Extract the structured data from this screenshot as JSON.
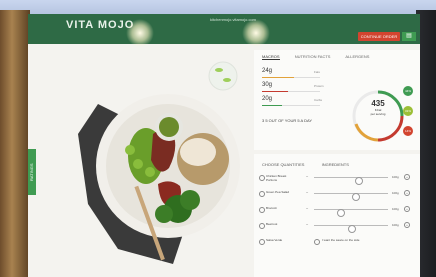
{
  "header": {
    "logo": "VITA MOJO",
    "url": "kitchenmojo.vitamojo.com",
    "continue_label": "CONTINUE ORDER",
    "cart_icon": "cart-icon"
  },
  "sidetab": {
    "label": "RATINGS"
  },
  "nutrition": {
    "tabs": [
      "MACROS",
      "NUTRITION FACTS",
      "ALLERGENS"
    ],
    "macros": [
      {
        "value": "24g",
        "label": "Fats",
        "color": "#e2a23a",
        "fraction": 0.55
      },
      {
        "value": "30g",
        "label": "Protein",
        "color": "#c43a2f",
        "fraction": 0.45
      },
      {
        "value": "20g",
        "label": "Carbs",
        "color": "#3f9b52",
        "fraction": 0.35
      }
    ],
    "five_a_day": "3  5 OUT OF YOUR 5 A DAY",
    "kcal_value": "435",
    "kcal_unit": "KCal",
    "kcal_sub": "per serving",
    "badges": [
      {
        "text": "44%",
        "color": "#3f9b52"
      },
      {
        "text": "31%",
        "color": "#9cbf36"
      },
      {
        "text": "14%",
        "color": "#d2442f"
      }
    ]
  },
  "ingredients": {
    "tabs": [
      "CHOOSE QUANTITIES",
      "INGREDIENTS"
    ],
    "rows": [
      {
        "name": "Chicken Breast Portions",
        "grams": "100g",
        "level": 0.6
      },
      {
        "name": "Green Pea Salad",
        "grams": "100g",
        "level": 0.55
      },
      {
        "name": "Broccoli",
        "grams": "100g",
        "level": 0.35
      },
      {
        "name": "Beetroot",
        "grams": "100g",
        "level": 0.5
      },
      {
        "name": "Salsa Verde",
        "grams": "",
        "level": null
      }
    ],
    "sauce_note": "I want the sauce on the side"
  }
}
